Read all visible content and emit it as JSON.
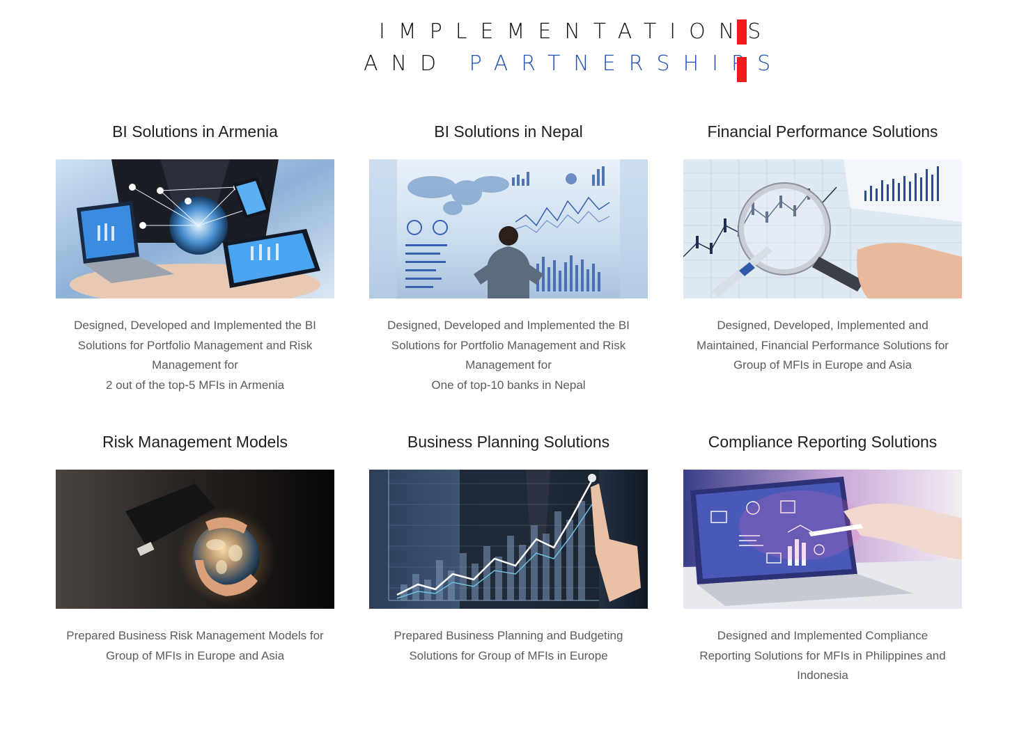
{
  "header": {
    "title_line1": "IMPLEMENTATIONS",
    "title_line2_prefix": "AND ",
    "title_line2_accent": "PARTNERSHIPS",
    "accent_color": "#1f4fb3",
    "bar_color": "#ef1b1b"
  },
  "cards": [
    {
      "title": "BI Solutions in Armenia",
      "image": "laptop-tablet-network-illustration",
      "desc_lines": [
        "Designed, Developed and Implemented the BI",
        "Solutions for Portfolio Management and Risk",
        "Management for",
        "2 out of the top-5 MFIs in Armenia"
      ]
    },
    {
      "title": "BI Solutions in Nepal",
      "image": "businessman-dashboard-illustration",
      "desc_lines": [
        "Designed, Developed and Implemented the BI",
        "Solutions for Portfolio Management and Risk",
        "Management for",
        "One of top-10 banks in Nepal"
      ]
    },
    {
      "title": "Financial Performance Solutions",
      "image": "magnifier-stock-chart-illustration",
      "desc_lines": [
        "Designed, Developed, Implemented and",
        "Maintained, Financial Performance Solutions for",
        "Group of MFIs in Europe and Asia"
      ]
    },
    {
      "title": "Risk Management Models",
      "image": "hands-glowing-globe-illustration",
      "desc_lines": [
        "Prepared Business Risk Management Models for",
        "Group of MFIs in Europe and Asia"
      ]
    },
    {
      "title": "Business Planning Solutions",
      "image": "rising-growth-chart-illustration",
      "desc_lines": [
        "Prepared Business Planning and Budgeting",
        "Solutions for Group of MFIs in Europe"
      ]
    },
    {
      "title": "Compliance Reporting Solutions",
      "image": "laptop-reporting-icons-illustration",
      "desc_lines": [
        "Designed and Implemented Compliance",
        "Reporting Solutions for MFIs in Philippines and",
        "Indonesia"
      ]
    }
  ]
}
